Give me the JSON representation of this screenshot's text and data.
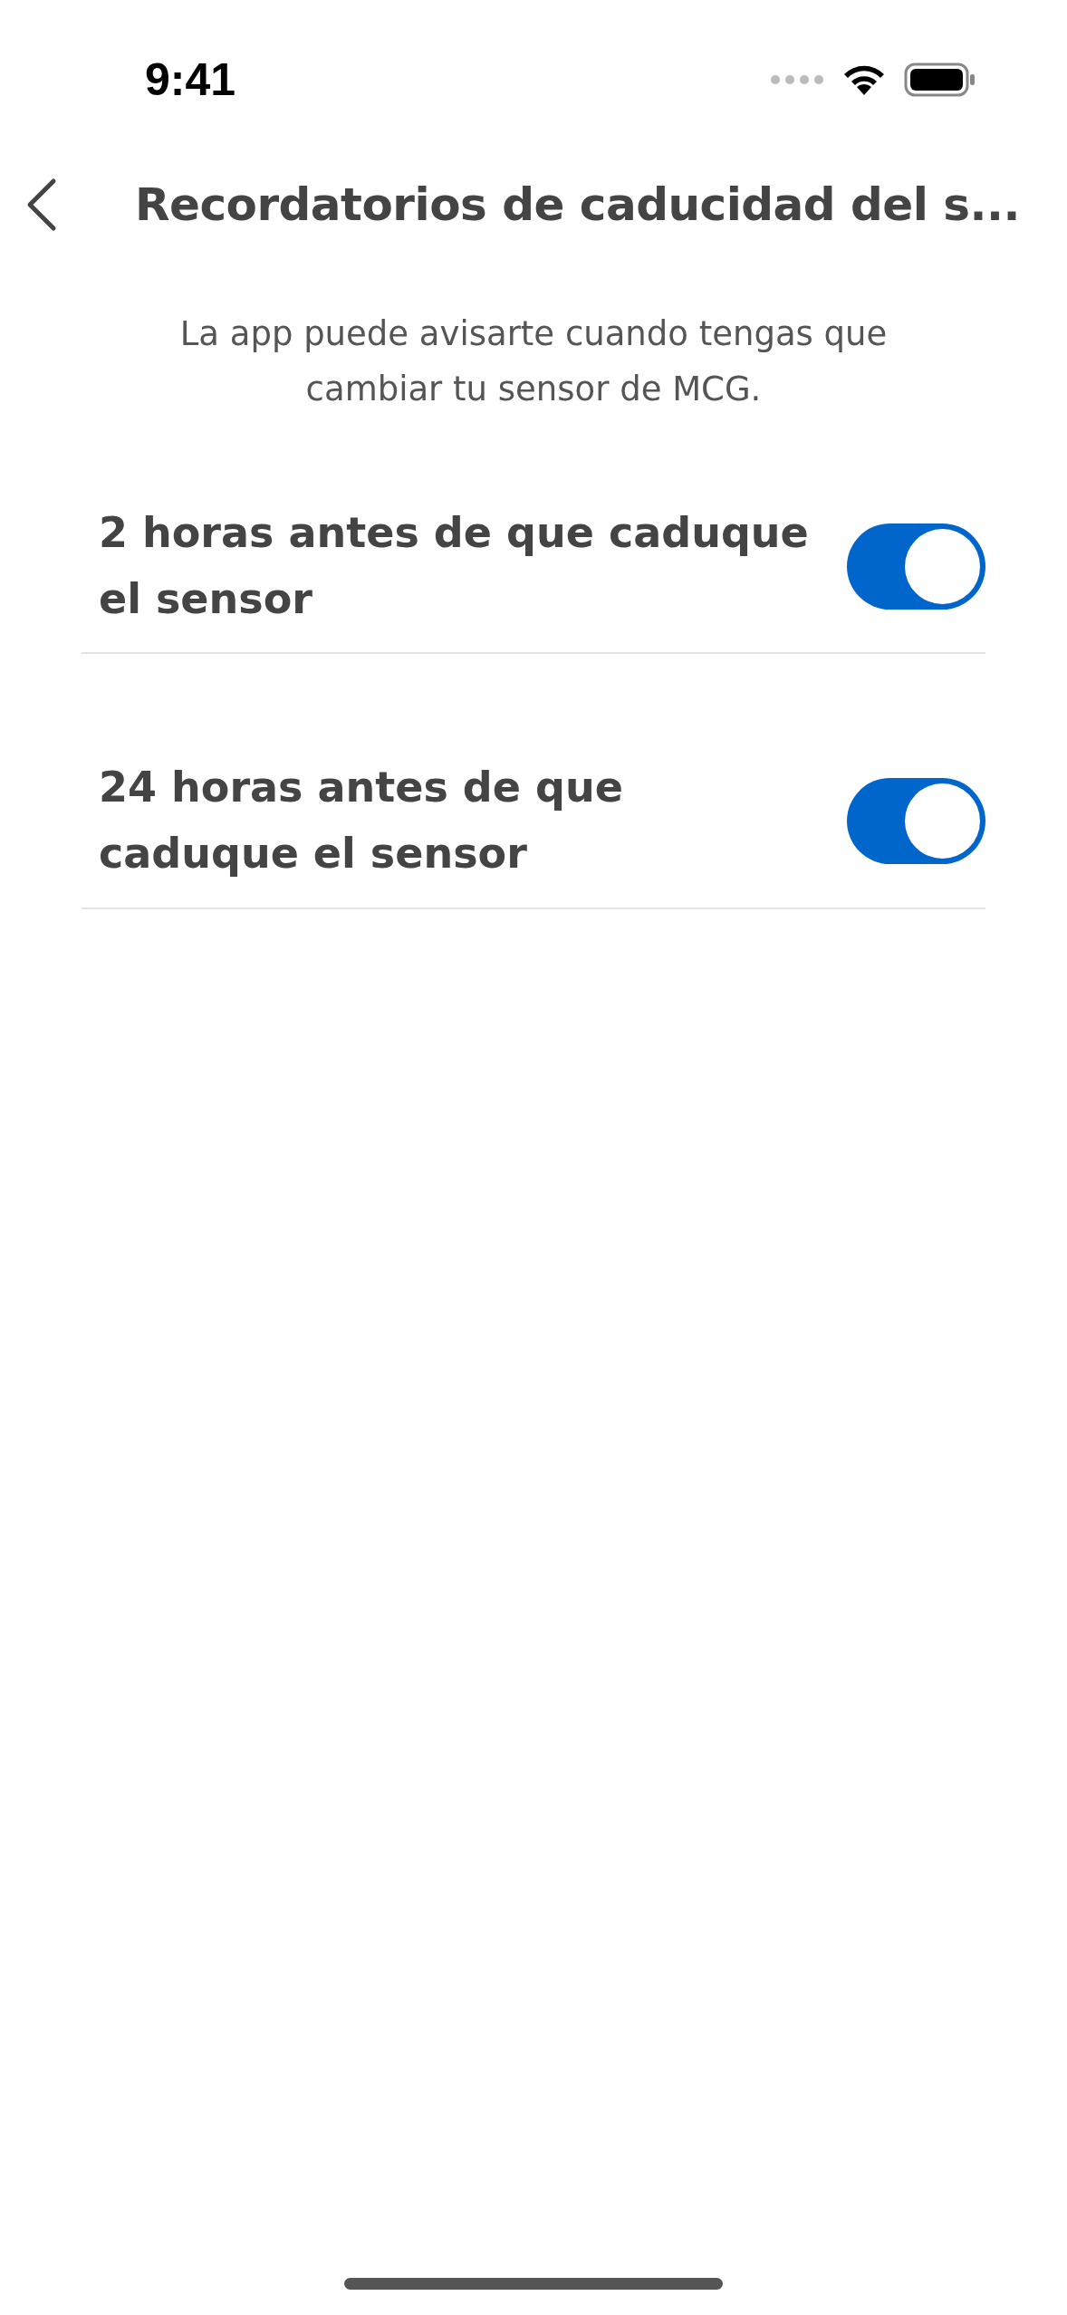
{
  "status_bar": {
    "time": "9:41"
  },
  "header": {
    "title": "Recordatorios de caducidad del s..."
  },
  "description": "La app puede avisarte cuando tengas que cambiar tu sensor de MCG.",
  "settings": [
    {
      "label": "2 horas antes de que caduque el sensor",
      "on": true
    },
    {
      "label": "24 horas antes de que caduque el sensor",
      "on": true
    }
  ]
}
